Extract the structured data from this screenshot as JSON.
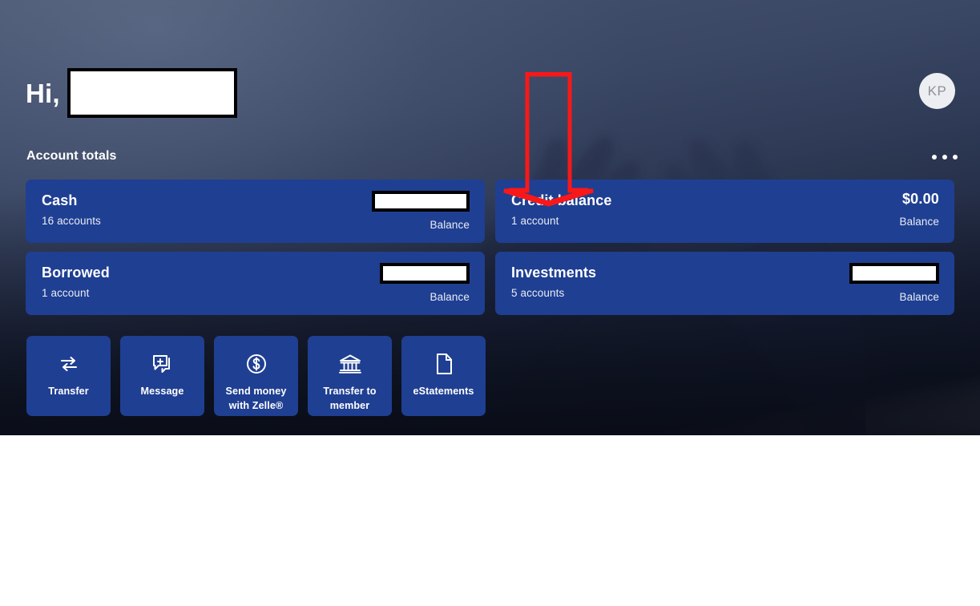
{
  "header": {
    "greeting": "Hi,",
    "name_redacted": true,
    "avatar_initials": "KP",
    "avatar_name": "account-avatar"
  },
  "section": {
    "title": "Account totals",
    "overflow_menu": "more-options"
  },
  "accounts": [
    {
      "name": "Cash",
      "subtitle": "16 accounts",
      "amount": "",
      "amount_redacted": true,
      "balance_label": "Balance"
    },
    {
      "name": "Credit balance",
      "subtitle": "1 account",
      "amount": "$0.00",
      "amount_redacted": false,
      "balance_label": "Balance"
    },
    {
      "name": "Borrowed",
      "subtitle": "1 account",
      "amount": "",
      "amount_redacted": true,
      "balance_label": "Balance"
    },
    {
      "name": "Investments",
      "subtitle": "5 accounts",
      "amount": "",
      "amount_redacted": true,
      "balance_label": "Balance"
    }
  ],
  "quick_actions": [
    {
      "label": "Transfer",
      "icon": "transfer-arrows-icon"
    },
    {
      "label": "Message",
      "icon": "message-bubble-plus-icon"
    },
    {
      "label": "Send money\nwith Zelle®",
      "icon": "dollar-circle-icon"
    },
    {
      "label": "Transfer to\nmember",
      "icon": "bank-building-icon"
    },
    {
      "label": "eStatements",
      "icon": "document-page-icon"
    }
  ],
  "annotation": {
    "type": "down-arrow",
    "color": "#f81818",
    "points_at": "Credit balance"
  },
  "colors": {
    "card_blue": "#1f3f92",
    "hero_top": "#4a566f",
    "hero_bottom": "#11162a",
    "annotation_red": "#f81818",
    "avatar_bg": "#eceef1",
    "page_bg": "#ffffff"
  }
}
